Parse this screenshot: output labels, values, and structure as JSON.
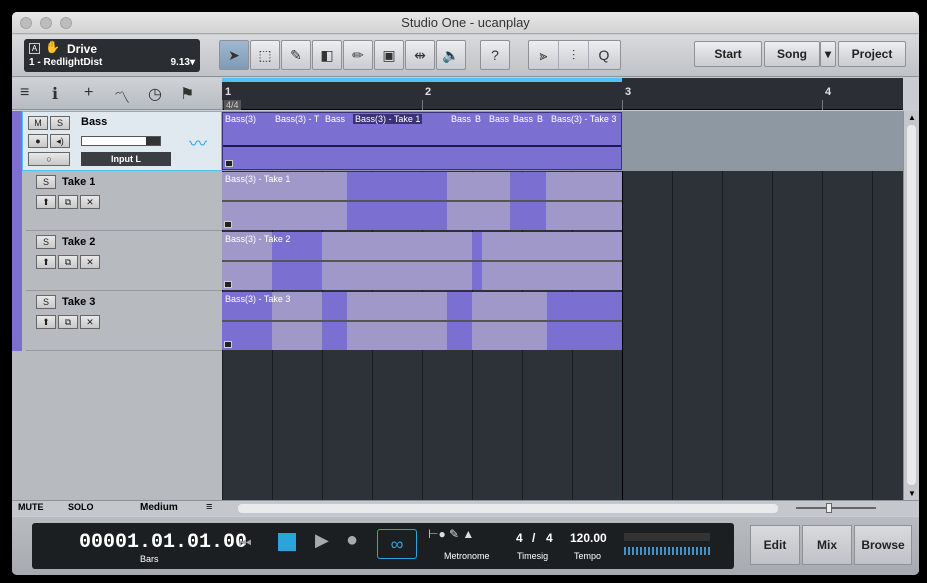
{
  "window": {
    "title": "Studio One - ucanplay"
  },
  "device": {
    "badge": "A",
    "name": "Drive",
    "preset": "1 - RedlightDist",
    "version": "9.13"
  },
  "toolbar": {
    "tools": [
      "arrow-tool-icon",
      "range-tool-icon",
      "split-tool-icon",
      "eraser-tool-icon",
      "paint-tool-icon",
      "mute-tool-icon",
      "bend-tool-icon",
      "listen-tool-icon"
    ],
    "help_label": "?",
    "q_label": "Q",
    "start_label": "Start",
    "song_label": "Song",
    "project_label": "Project"
  },
  "ruler": {
    "bars": [
      "1",
      "2",
      "3",
      "4"
    ],
    "timesig": "4/4"
  },
  "tracks": [
    {
      "name": "Bass",
      "input": "Input L"
    },
    {
      "name": "Take 1"
    },
    {
      "name": "Take 2"
    },
    {
      "name": "Take 3"
    }
  ],
  "clips": {
    "main": [
      "Bass(3)",
      "Bass(3) - T",
      "Bass",
      "Bass(3) - Take 1",
      "Bass",
      "B",
      "Bass",
      "Bass",
      "B",
      "Bass(3) - Take 3"
    ],
    "take1": "Bass(3) - Take 1",
    "take2": "Bass(3) - Take 2",
    "take3": "Bass(3) - Take 3"
  },
  "footer": {
    "mute": "MUTE",
    "solo": "SOLO",
    "size": "Medium"
  },
  "transport": {
    "time": "00001.01.01.00",
    "time_unit": "Bars",
    "metronome": "Metronome",
    "timesig_num": "4",
    "timesig_sep": "/",
    "timesig_den": "4",
    "timesig_label": "Timesig",
    "tempo": "120.00",
    "tempo_label": "Tempo",
    "edit": "Edit",
    "mix": "Mix",
    "browse": "Browse"
  },
  "colors": {
    "accent": "#7b6fd1",
    "loop": "#4fc3f7",
    "background": "#2d3138"
  }
}
